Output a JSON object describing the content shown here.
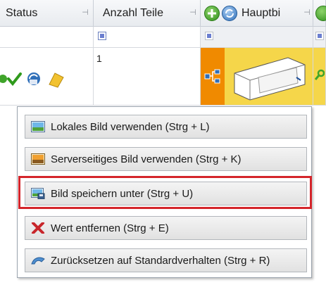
{
  "grid": {
    "columns": [
      {
        "header": "Status"
      },
      {
        "header": "Anzahl Teile"
      },
      {
        "header": "Hauptbi"
      }
    ],
    "row": {
      "anzahl_teile": "1"
    }
  },
  "context_menu": {
    "items": [
      {
        "label": "Lokales Bild verwenden (Strg + L)",
        "icon": "local-image-icon"
      },
      {
        "label": "Serverseitiges Bild verwenden (Strg + K)",
        "icon": "server-image-icon"
      },
      {
        "label": "Bild speichern unter (Strg + U)",
        "icon": "save-image-icon",
        "highlighted": true
      },
      {
        "label": "Wert entfernen (Strg + E)",
        "icon": "remove-x-icon"
      },
      {
        "label": "Zurücksetzen auf Standardverhalten (Strg + R)",
        "icon": "reset-icon"
      }
    ]
  },
  "colors": {
    "highlight_border": "#d4252b",
    "image_cell_bg": "#f5d64a",
    "status_cell_accent": "#f08a00"
  }
}
